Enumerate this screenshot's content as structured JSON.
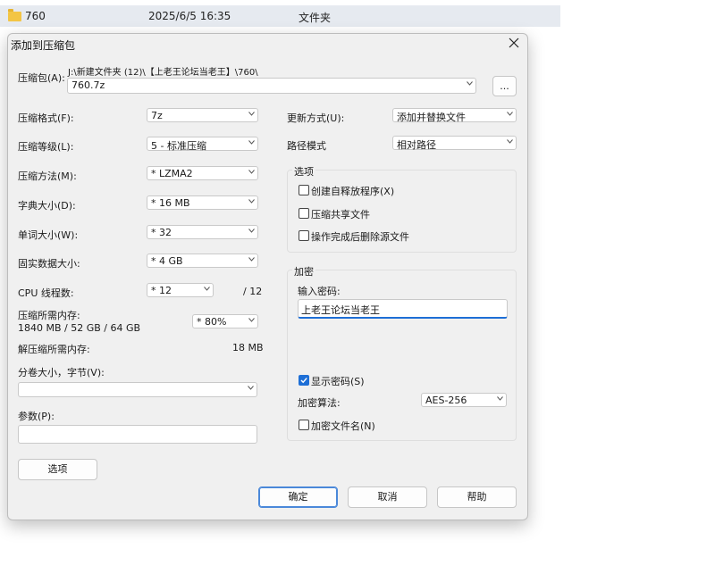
{
  "explorer_row": {
    "name": "760",
    "date": "2025/6/5 16:35",
    "type": "文件夹"
  },
  "dialog": {
    "title": "添加到压缩包",
    "archive_label": "压缩包(A):",
    "archive_path": "J:\\新建文件夹 (12)\\【上老王论坛当老王】\\760\\",
    "archive_name": "760.7z",
    "browse_label": "...",
    "left": {
      "format": {
        "label": "压缩格式(F):",
        "value": "7z"
      },
      "level": {
        "label": "压缩等级(L):",
        "value": "5 - 标准压缩"
      },
      "method": {
        "label": "压缩方法(M):",
        "value": "* LZMA2"
      },
      "dict": {
        "label": "字典大小(D):",
        "value": "* 16 MB"
      },
      "word": {
        "label": "单词大小(W):",
        "value": "* 32"
      },
      "solid": {
        "label": "固实数据大小:",
        "value": "* 4 GB"
      },
      "threads": {
        "label": "CPU 线程数:",
        "value": "* 12",
        "total": "/ 12"
      },
      "mem_compress": {
        "label": "压缩所需内存:",
        "detail": "1840 MB / 52 GB / 64 GB",
        "value": "* 80%"
      },
      "mem_decompress": {
        "label": "解压缩所需内存:",
        "value": "18 MB"
      },
      "split": {
        "label": "分卷大小，字节(V):",
        "value": ""
      },
      "params": {
        "label": "参数(P):",
        "value": ""
      },
      "options_button": "选项"
    },
    "right": {
      "update": {
        "label": "更新方式(U):",
        "value": "添加并替换文件"
      },
      "path_mode": {
        "label": "路径模式",
        "value": "相对路径"
      },
      "options_group": {
        "title": "选项",
        "items": [
          "创建自释放程序(X)",
          "压缩共享文件",
          "操作完成后删除源文件"
        ]
      },
      "encryption": {
        "title": "加密",
        "password_label": "输入密码:",
        "password_value": "上老王论坛当老王",
        "show_password": "显示密码(S)",
        "method_label": "加密算法:",
        "method_value": "AES-256",
        "encrypt_names": "加密文件名(N)"
      }
    },
    "buttons": {
      "ok": "确定",
      "cancel": "取消",
      "help": "帮助"
    }
  },
  "colors": {
    "accent": "#1e6fd6",
    "dialog_bg": "#f0f0f0"
  }
}
